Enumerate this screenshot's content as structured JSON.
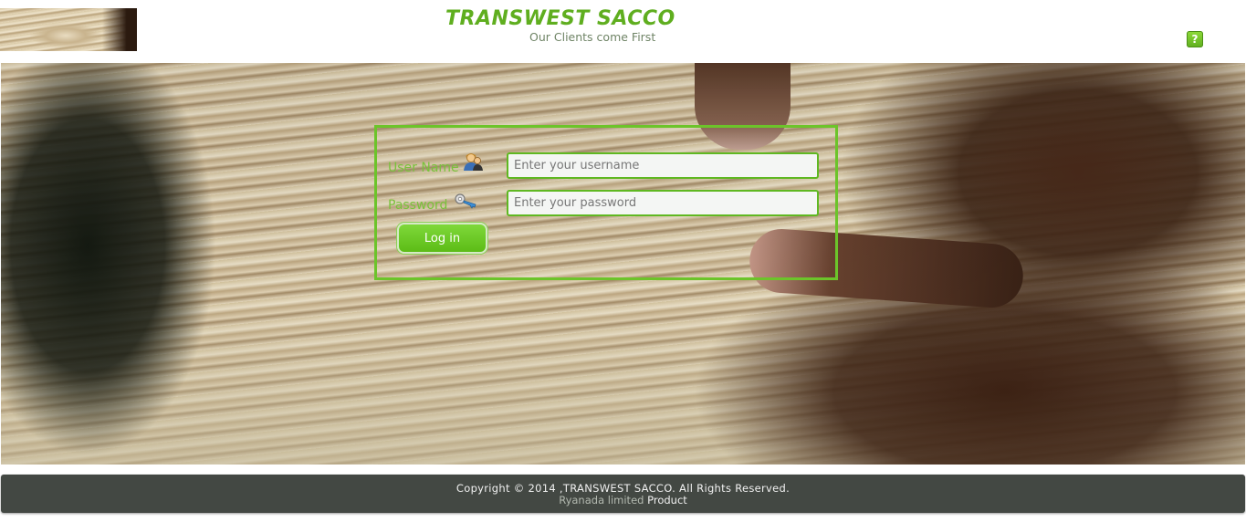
{
  "header": {
    "logo_icon": "money-bundle-thumbnail",
    "title": "TRANSWEST SACCO",
    "tagline": "Our Clients come First",
    "help_label": "?",
    "help_icon": "question-mark-icon"
  },
  "hero": {
    "image": "hands-holding-banknotes-photo"
  },
  "login": {
    "username_label": "User Name",
    "username_icon": "user-icon",
    "username_placeholder": "Enter your username",
    "username_value": "",
    "password_label": "Password",
    "password_icon": "key-icon",
    "password_placeholder": "Enter your password",
    "password_value": "",
    "login_button": "Log in"
  },
  "footer": {
    "copyright": "Copyright © 2014 ,TRANSWEST SACCO. All Rights Reserved.",
    "vendor": "Ryanada limited",
    "product": "Product"
  },
  "colors": {
    "brand_green": "#5fae1f",
    "panel_border": "#6cc42a",
    "footer_bg": "#434843"
  }
}
